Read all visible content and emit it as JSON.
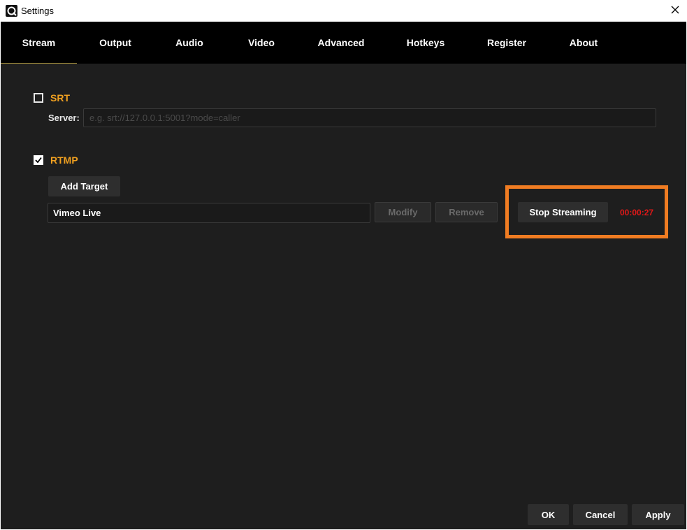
{
  "window": {
    "title": "Settings",
    "app_icon": "app-logo-icon",
    "close_icon": "close-icon"
  },
  "tabs": [
    {
      "label": "Stream",
      "active": true
    },
    {
      "label": "Output",
      "active": false
    },
    {
      "label": "Audio",
      "active": false
    },
    {
      "label": "Video",
      "active": false
    },
    {
      "label": "Advanced",
      "active": false
    },
    {
      "label": "Hotkeys",
      "active": false
    },
    {
      "label": "Register",
      "active": false
    },
    {
      "label": "About",
      "active": false
    }
  ],
  "srt": {
    "label": "SRT",
    "checked": false,
    "server_label": "Server:",
    "server_value": "",
    "server_placeholder": "e.g. srt://127.0.0.1:5001?mode=caller"
  },
  "rtmp": {
    "label": "RTMP",
    "checked": true,
    "add_target_label": "Add Target",
    "target_name": "Vimeo Live",
    "modify_label": "Modify",
    "remove_label": "Remove",
    "stop_streaming_label": "Stop Streaming",
    "elapsed": "00:00:27"
  },
  "footer": {
    "ok_label": "OK",
    "cancel_label": "Cancel",
    "apply_label": "Apply"
  },
  "colors": {
    "accent": "#f0a020",
    "highlight": "#f07c22",
    "timer": "#e01818",
    "background": "#1e1e1e",
    "tabbar": "#000000"
  }
}
